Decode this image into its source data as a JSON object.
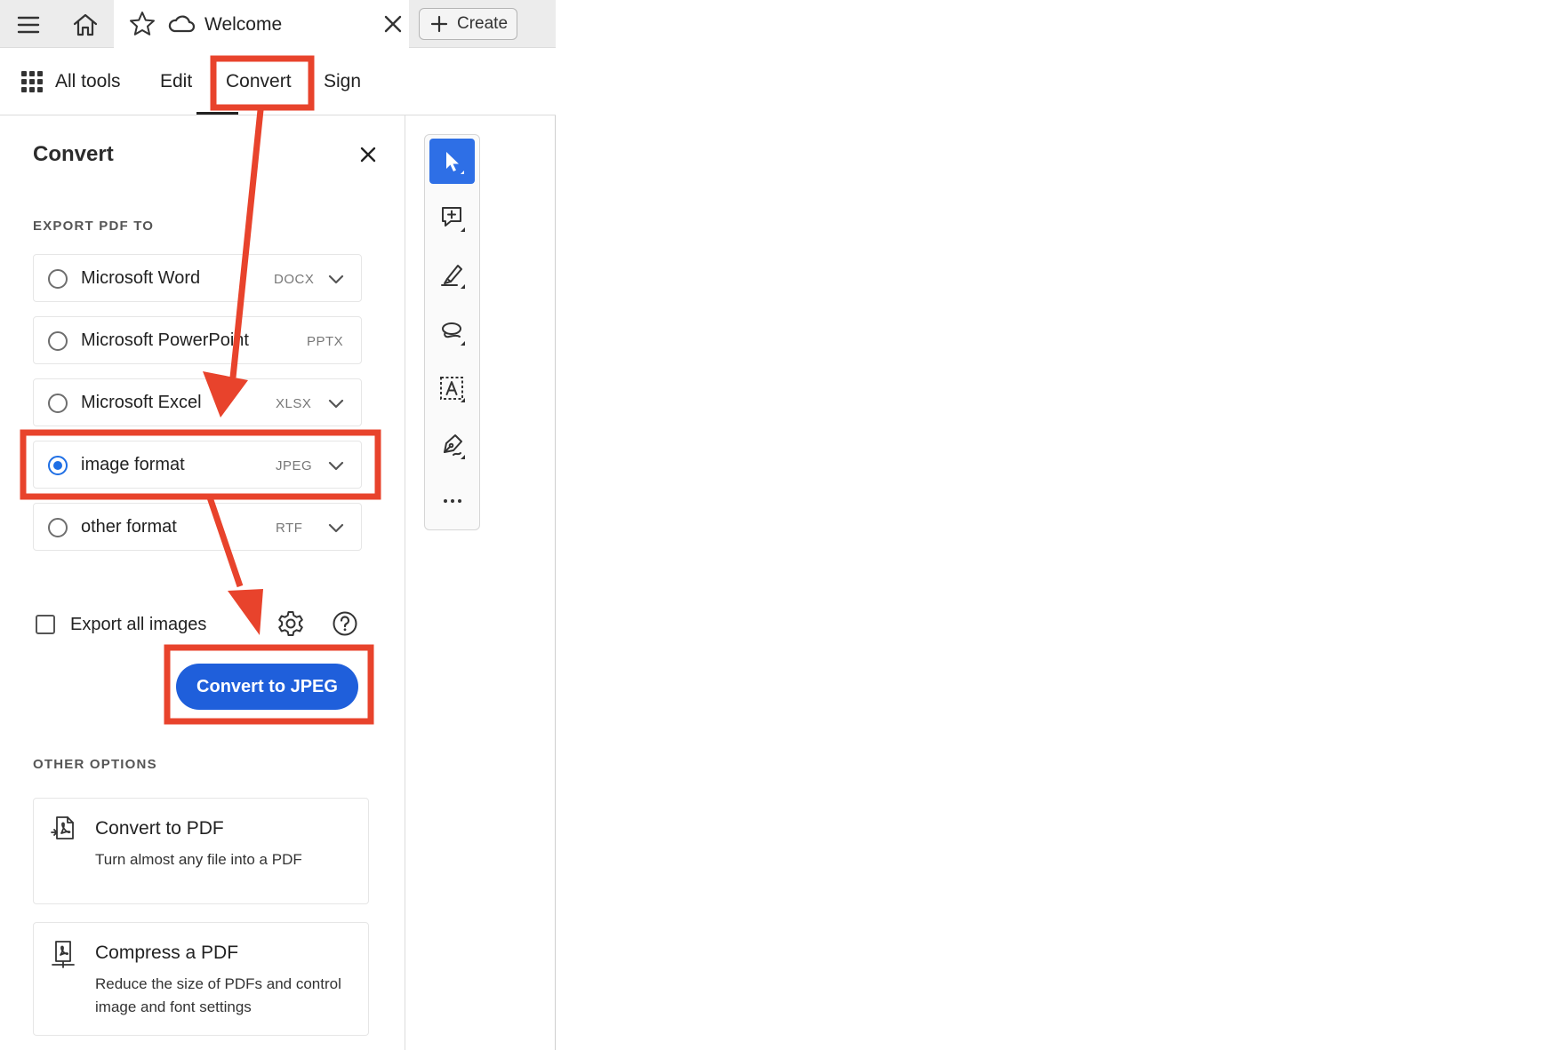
{
  "tabstrip": {
    "menu_icon": "hamburger-icon",
    "home_icon": "home-icon",
    "star_icon": "star-icon",
    "cloud_icon": "cloud-icon",
    "tab_title": "Welcome",
    "close_icon": "close-icon",
    "create_label": "Create"
  },
  "menubar": {
    "all_tools": "All tools",
    "edit": "Edit",
    "convert": "Convert",
    "sign": "Sign",
    "active": "Convert"
  },
  "panel": {
    "title": "Convert",
    "export_label": "EXPORT PDF TO",
    "options": [
      {
        "name": "Microsoft Word",
        "format": "DOCX",
        "selected": false,
        "dropdown": true
      },
      {
        "name": "Microsoft PowerPoint",
        "format": "PPTX",
        "selected": false,
        "dropdown": false
      },
      {
        "name": "Microsoft Excel",
        "format": "XLSX",
        "selected": false,
        "dropdown": true
      },
      {
        "name": "image format",
        "format": "JPEG",
        "selected": true,
        "dropdown": true
      },
      {
        "name": "other format",
        "format": "RTF",
        "selected": false,
        "dropdown": true
      }
    ],
    "export_all_images": "Export all images",
    "export_all_checked": false,
    "convert_button": "Convert to JPEG",
    "other_options_label": "OTHER OPTIONS",
    "cards": [
      {
        "title": "Convert to PDF",
        "desc": "Turn almost any file into a PDF",
        "icon": "convert-to-pdf-icon"
      },
      {
        "title": "Compress a PDF",
        "desc": "Reduce the size of PDFs and control image and font settings",
        "icon": "compress-pdf-icon"
      }
    ]
  },
  "toolbar": {
    "tools": [
      "select-cursor-icon",
      "add-comment-icon",
      "highlight-pen-icon",
      "draw-lasso-icon",
      "select-text-icon",
      "sign-pen-icon",
      "more-icon"
    ],
    "active": "select-cursor-icon"
  },
  "colors": {
    "accent": "#1f5fdb",
    "radio_selected": "#1f6fe5",
    "annotation_red": "#e8432c"
  }
}
